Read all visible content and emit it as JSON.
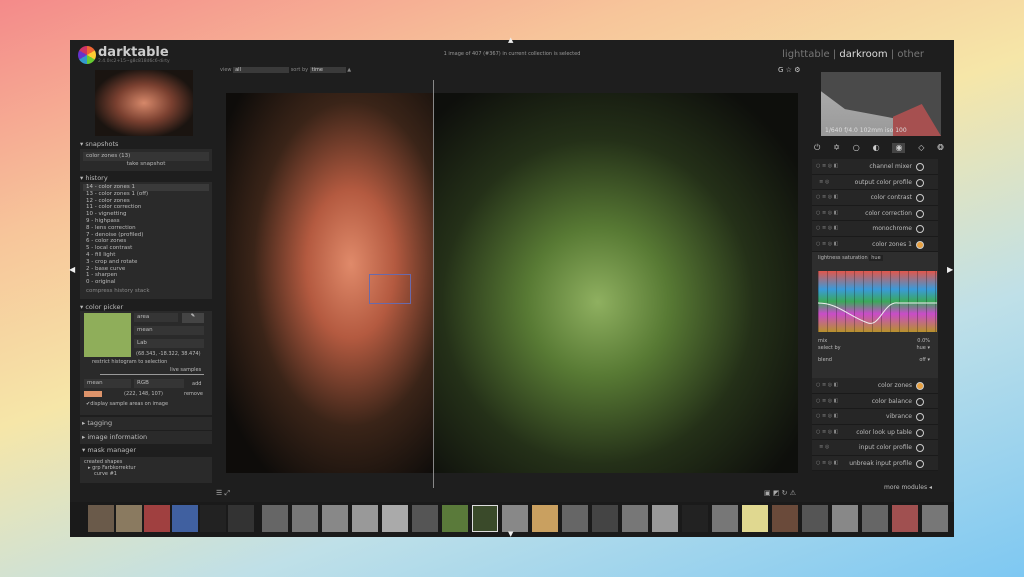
{
  "app": {
    "name": "darktable",
    "version": "2.4.0rc2+15~g8c818d6c6-dirty"
  },
  "status": "1 image of 407 (#367) in current collection is selected",
  "views": [
    "lighttable",
    "darkroom",
    "other"
  ],
  "active_view": "darkroom",
  "filter": {
    "view_label": "view",
    "view_value": "all",
    "sort_label": "sort by",
    "sort_value": "time"
  },
  "snapshots": {
    "title": "snapshots",
    "items": [
      "color zones (13)"
    ],
    "take": "take snapshot"
  },
  "history": {
    "title": "history",
    "items": [
      "14 - color zones 1",
      "13 - color zones 1 (off)",
      "12 - color zones",
      "11 - color correction",
      "10 - vignetting",
      "9 - highpass",
      "8 - lens correction",
      "7 - denoise (profiled)",
      "6 - color zones",
      "5 - local contrast",
      "4 - fill light",
      "3 - crop and rotate",
      "2 - base curve",
      "1 - sharpen",
      "0 - original"
    ],
    "compress": "compress history stack"
  },
  "color_picker": {
    "title": "color picker",
    "mode": "area",
    "stat": "mean",
    "space": "Lab",
    "value": "(68.343, -18.322, 38.474)",
    "restrict": "restrict histogram to selection",
    "live": "live samples",
    "sample_stat": "mean",
    "sample_space": "RGB",
    "add": "add",
    "sample_value": "(222, 148, 107)",
    "remove": "remove",
    "display": "display sample areas on image",
    "swatch": "#8fae5a",
    "sample_swatch": "#de946b"
  },
  "tagging": "tagging",
  "image_information": "image information",
  "mask_manager": {
    "title": "mask manager",
    "created": "created shapes",
    "items": [
      "grp Farbkorrektur",
      "curve #1"
    ]
  },
  "histogram_info": "1/640 f/4.0 102mm iso 100",
  "modules_top": [
    "channel mixer",
    "output color profile",
    "color contrast",
    "color correction",
    "monochrome",
    "color zones 1"
  ],
  "colorzones": {
    "tabs": [
      "lightness",
      "saturation",
      "hue"
    ],
    "active_tab": "hue",
    "mix_label": "mix",
    "mix_value": "0.0%",
    "select_by_label": "select by",
    "select_by_value": "hue",
    "blend_label": "blend",
    "blend_value": "off"
  },
  "modules_bottom": [
    "color zones",
    "color balance",
    "vibrance",
    "color look up table",
    "input color profile",
    "unbreak input profile"
  ],
  "more_modules": "more modules"
}
